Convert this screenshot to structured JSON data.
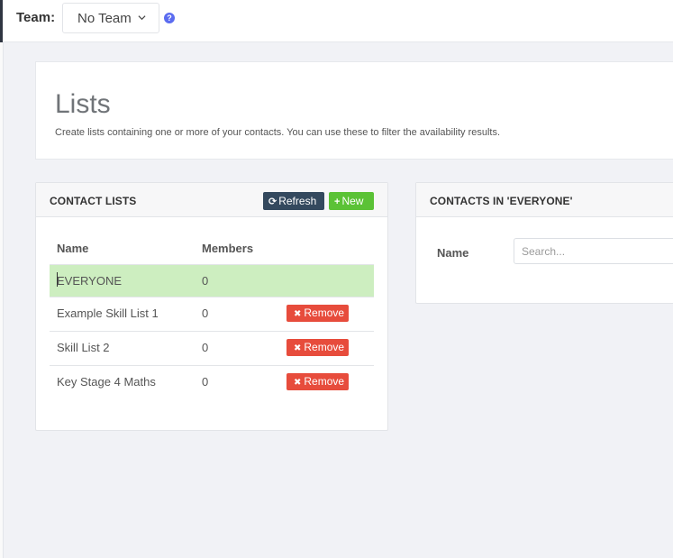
{
  "topbar": {
    "team_label": "Team:",
    "team_value": "No Team",
    "help_glyph": "?"
  },
  "header": {
    "title": "Lists",
    "description": "Create lists containing one or more of your contacts. You can use these to filter the availability results."
  },
  "contact_lists": {
    "title": "CONTACT LISTS",
    "refresh_label": "Refresh",
    "new_label": "New",
    "columns": [
      "Name",
      "Members"
    ],
    "remove_label": "Remove",
    "rows": [
      {
        "name": "EVERYONE",
        "members": "0",
        "selected": true
      },
      {
        "name": "Example Skill List 1",
        "members": "0"
      },
      {
        "name": "Skill List 2",
        "members": "0"
      },
      {
        "name": "Key Stage 4 Maths",
        "members": "0"
      }
    ]
  },
  "contacts_in": {
    "title": "CONTACTS IN 'EVERYONE'",
    "name_label": "Name",
    "search_placeholder": "Search..."
  },
  "colors": {
    "refresh": "#34495e",
    "new": "#5bc236",
    "remove": "#e74c3c",
    "selected_row": "#cdeec0",
    "help_icon": "#5b6cf0"
  }
}
